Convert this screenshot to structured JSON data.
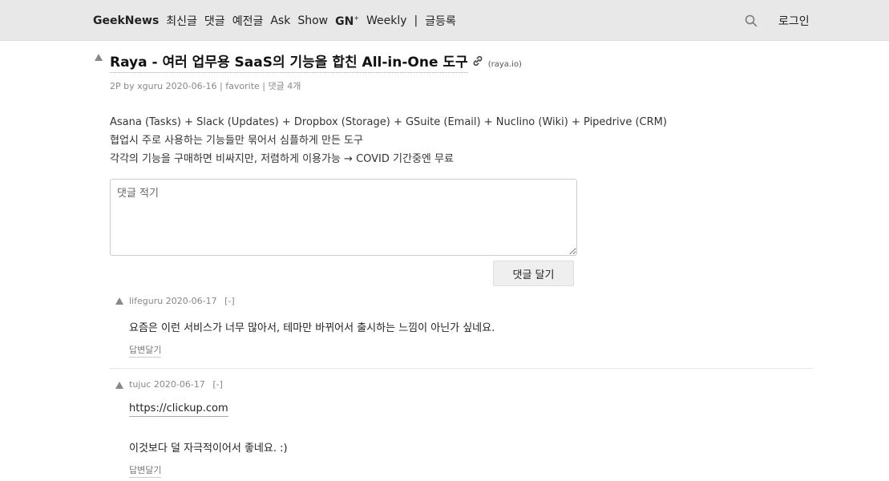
{
  "nav": {
    "brand": "GeekNews",
    "items": [
      "최신글",
      "댓글",
      "예전글",
      "Ask",
      "Show"
    ],
    "gn_label": "GN",
    "gn_sup": "+",
    "weekly": "Weekly",
    "separator": "|",
    "submit": "글등록",
    "search_icon": "search-icon",
    "login": "로그인"
  },
  "post": {
    "title": "Raya - 여러 업무용 SaaS의 기능을 합친 All-in-One 도구",
    "domain": "(raya.io)",
    "points": "2P",
    "by": "by",
    "author": "xguru",
    "date": "2020-06-16",
    "sep": "|",
    "favorite": "favorite",
    "comments": "댓글 4개",
    "description": [
      "Asana (Tasks) + Slack (Updates) + Dropbox (Storage) + GSuite (Email) + Nuclino (Wiki) + Pipedrive (CRM)",
      "협업시 주로 사용하는 기능들만 묶어서 심플하게 만든 도구",
      "각각의 기능을 구매하면 비싸지만, 저렴하게 이용가능 → COVID 기간중엔 무료"
    ]
  },
  "comment_form": {
    "placeholder": "댓글 적기",
    "submit_label": "댓글 달기"
  },
  "comments": [
    {
      "user": "lifeguru",
      "date": "2020-06-17",
      "toggle": "[-]",
      "text": "요즘은 이런 서비스가 너무 많아서, 테마만 바뀌어서 출시하는 느낌이 아닌가 싶네요.",
      "reply": "답변달기"
    },
    {
      "user": "tujuc",
      "date": "2020-06-17",
      "toggle": "[-]",
      "link": "https://clickup.com",
      "text": "이것보다 덜 자극적이어서 좋네요. :)",
      "reply": "답변달기"
    }
  ]
}
